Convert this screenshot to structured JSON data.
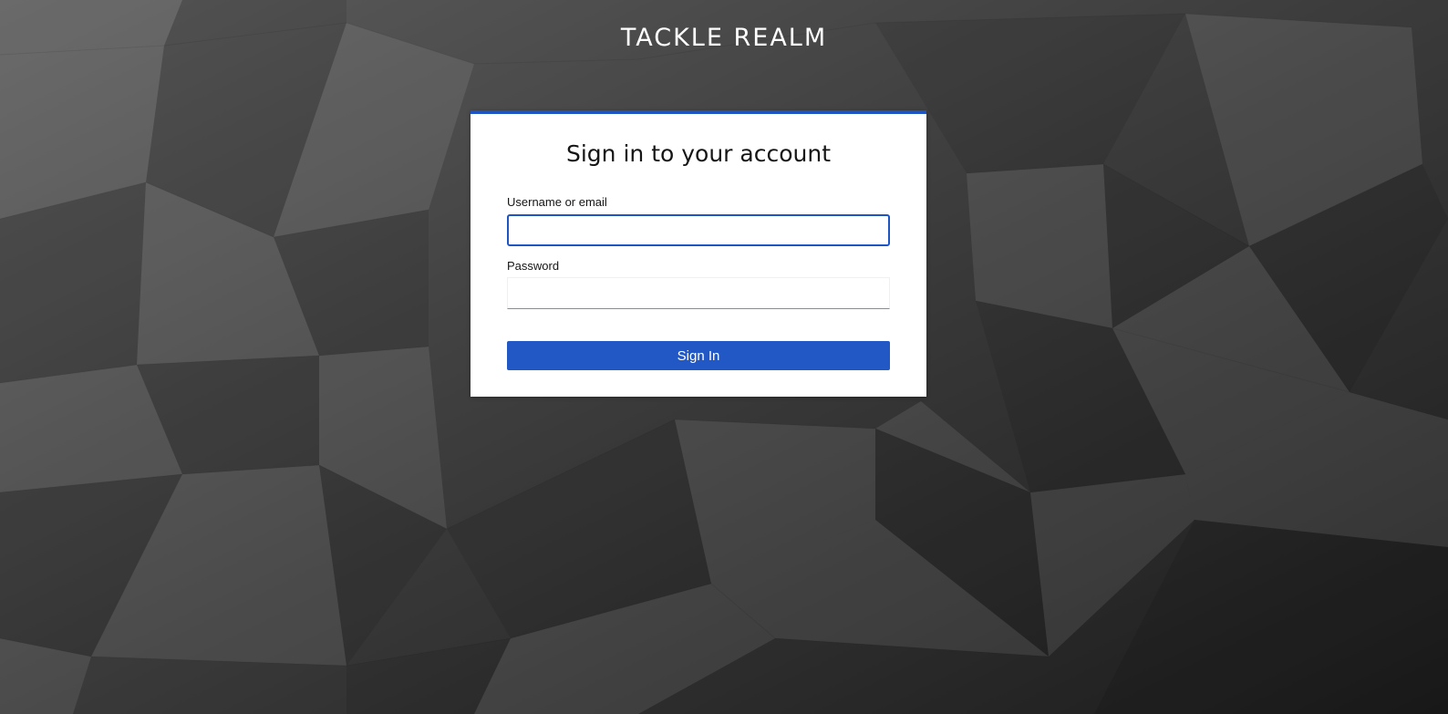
{
  "realm": {
    "title": "TACKLE REALM"
  },
  "login_card": {
    "heading": "Sign in to your account",
    "username_label": "Username or email",
    "username_value": "",
    "password_label": "Password",
    "password_value": "",
    "submit_label": "Sign In"
  },
  "colors": {
    "accent": "#1f55c3",
    "button": "#2258c5",
    "background_dark": "#1c1c1c",
    "background_light": "#5a5a5a",
    "card": "#ffffff"
  }
}
